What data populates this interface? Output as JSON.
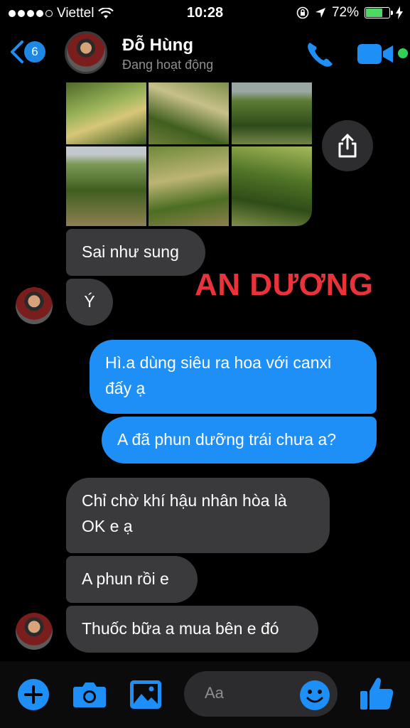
{
  "status_bar": {
    "carrier": "Viettel",
    "time": "10:28",
    "battery_percent": "72%",
    "battery_level": 0.72
  },
  "header": {
    "unread_badge": "6",
    "contact_name": "Đỗ Hùng",
    "contact_status": "Đang hoạt động",
    "active_color": "#31d158"
  },
  "watermark": "AN DƯƠNG",
  "messages": [
    {
      "from": "contact",
      "text": "Sai như sung"
    },
    {
      "from": "contact",
      "text": "Ý"
    },
    {
      "from": "me",
      "line1": "Hì.a dùng siêu ra hoa với canxi",
      "line2": "đấy ạ"
    },
    {
      "from": "me",
      "text": "A đã phun dưỡng trái chưa a?"
    },
    {
      "from": "contact",
      "line1": "Chỉ chờ khí hậu nhân hòa là",
      "line2": "OK e ạ"
    },
    {
      "from": "contact",
      "text": "A phun rồi e"
    },
    {
      "from": "contact",
      "text": "Thuốc bữa a mua bên e đó"
    }
  ],
  "composer": {
    "placeholder": "Aa"
  },
  "colors": {
    "accent": "#1e8ff7",
    "incoming_bubble": "#3a3a3c",
    "watermark": "#e8333a"
  },
  "icons": [
    "back-chevron-icon",
    "phone-icon",
    "video-camera-icon",
    "share-icon",
    "plus-icon",
    "camera-icon",
    "image-icon",
    "emoji-icon",
    "thumbs-up-icon"
  ]
}
